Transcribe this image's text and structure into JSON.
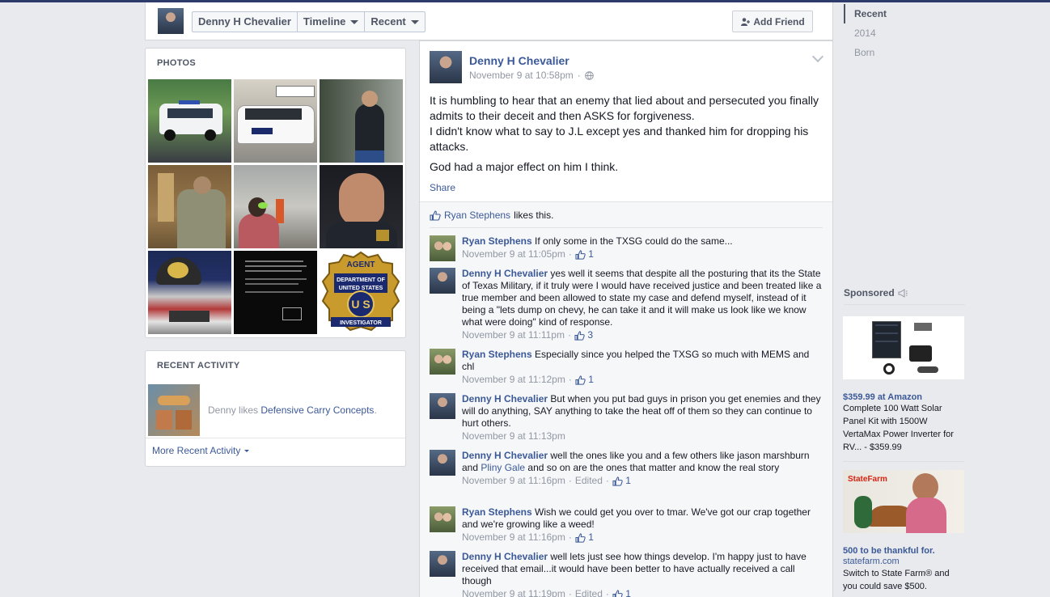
{
  "header": {
    "name": "Denny H Chevalier",
    "timeline": "Timeline",
    "recent": "Recent",
    "add_friend": "Add Friend"
  },
  "scrubber": [
    "Recent",
    "2014",
    "Born"
  ],
  "photos": {
    "title": "PHOTOS",
    "badge_top": "AGENT",
    "badge_mid1": "DEPARTMENT OF",
    "badge_mid2": "UNITED STATES",
    "badge_letters": "U S",
    "badge_bottom": "INVESTIGATOR"
  },
  "activity": {
    "title": "RECENT ACTIVITY",
    "actor": "Denny likes",
    "page": "Defensive Carry Concepts",
    "more": "More Recent Activity"
  },
  "post": {
    "author": "Denny H Chevalier",
    "time": "November 9 at 10:58pm",
    "dot": "·",
    "p1": "It is humbling to hear that an enemy that lied about and persecuted you finally admits to their deceit and then ASKS for forgiveness.",
    "p1b": "I didn't know what to say to J.L except yes and thanked him for dropping his attacks.",
    "p2": "God had a major effect on him I think.",
    "share": "Share",
    "liker": "Ryan Stephens",
    "likes_suffix": "likes this."
  },
  "comments": [
    {
      "name": "Ryan Stephens",
      "text": "If only some in the TXSG could do the same...",
      "time": "November 9 at 11:05pm",
      "edited": "",
      "likes": "1"
    },
    {
      "name": "Denny H Chevalier",
      "text": "yes well it seems that despite all the posturing that its the State of Texas Military, if it truly were I would have received justice and been treated like a true member and been allowed to state my case and defend myself, instead of it being a \"lets dump on chevy, he can take it and it will make us look like we know what were doing\" kind of response.",
      "time": "November 9 at 11:11pm",
      "edited": "",
      "likes": "3"
    },
    {
      "name": "Ryan Stephens",
      "text": "Especially since you helped the TXSG so much with MEMS and chl",
      "time": "November 9 at 11:12pm",
      "edited": "",
      "likes": "1"
    },
    {
      "name": "Denny H Chevalier",
      "text": "But when you put bad guys in prison you get enemies and they will do anything, SAY anything to take the heat off of them so they can continue to hurt others.",
      "time": "November 9 at 11:13pm",
      "edited": "",
      "likes": ""
    },
    {
      "name": "Denny H Chevalier",
      "text_a": "well the ones like you and a few others like jason marshburn and ",
      "link": "Pliny Gale",
      "text_b": " and so on are the ones that matter and know the real story",
      "time": "November 9 at 11:16pm",
      "edited": "Edited",
      "likes": "1"
    },
    {
      "name": "Ryan Stephens",
      "text": "Wish we could get you over to tmar. We've got our crap together and we're growing like a weed!",
      "time": "November 9 at 11:16pm",
      "edited": "",
      "likes": "1"
    },
    {
      "name": "Denny H Chevalier",
      "text": "well lets just see how things develop. I'm happy just to have received that email...it would have been better to have actually received a call though",
      "time": "November 9 at 11:19pm",
      "edited": "Edited",
      "likes": "1"
    }
  ],
  "sponsored": {
    "title": "Sponsored",
    "ad1": {
      "title": "$359.99 at Amazon",
      "text": "Complete 100 Watt Solar Panel Kit with 1500W VertaMax Power Inverter for RV... - $359.99"
    },
    "ad2": {
      "brand": "StateFarm",
      "title": "500 to be thankful for.",
      "domain": "statefarm.com",
      "text": "Switch to State Farm® and you could save $500."
    }
  },
  "colors": {
    "link": "#3b5998",
    "muted": "#9197a3",
    "bg": "#e9eaed"
  }
}
